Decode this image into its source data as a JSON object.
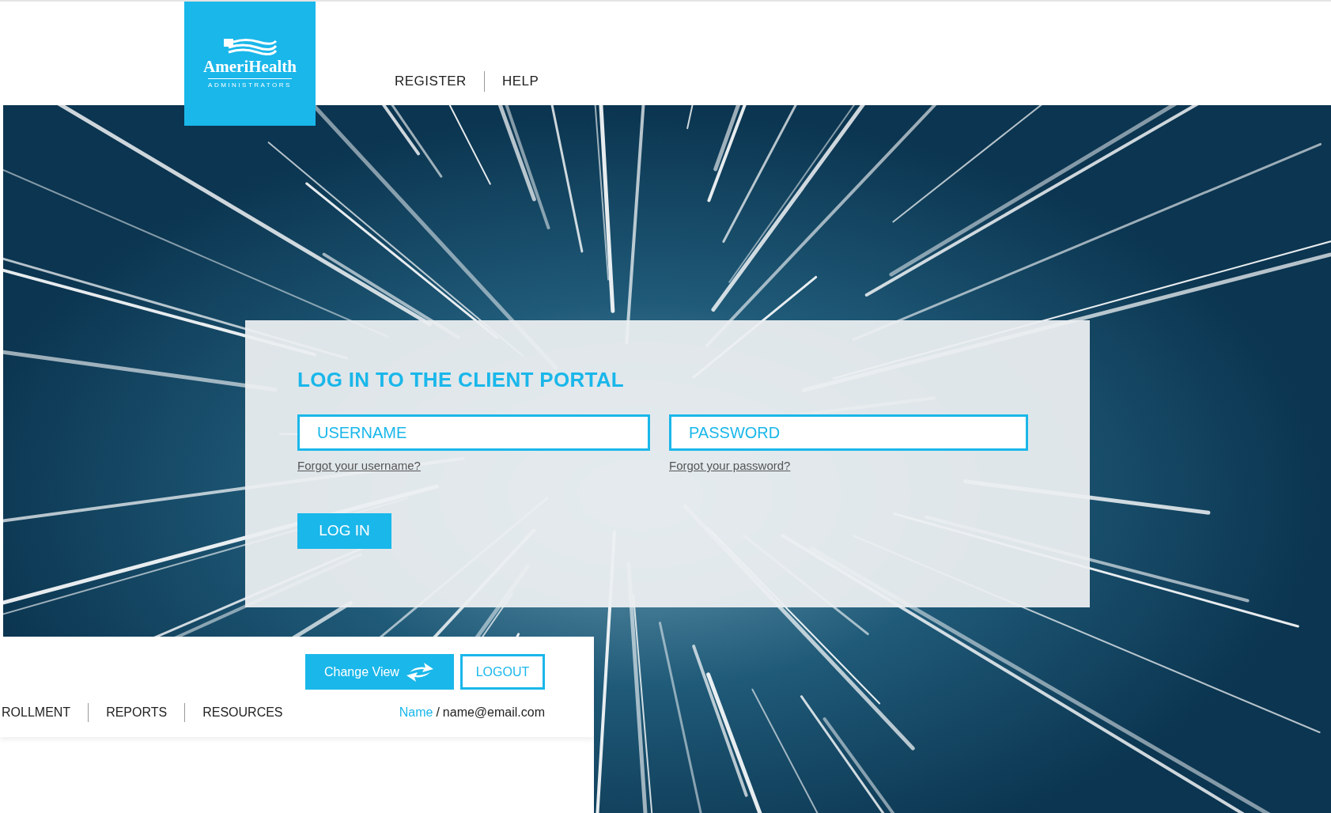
{
  "logo": {
    "name": "AmeriHealth",
    "tagline": "ADMINISTRATORS"
  },
  "top_nav": [
    {
      "label": "REGISTER"
    },
    {
      "label": "HELP"
    }
  ],
  "login": {
    "title": "LOG IN TO THE CLIENT PORTAL",
    "username": {
      "placeholder": "USERNAME"
    },
    "password": {
      "placeholder": "PASSWORD"
    },
    "forgot_username": "Forgot your username?",
    "forgot_password": "Forgot your password?",
    "submit": "LOG IN"
  },
  "overlay_panel": {
    "change_view": "Change View",
    "logout": "LOGOUT",
    "nav": [
      {
        "label": "ROLLMENT"
      },
      {
        "label": "REPORTS"
      },
      {
        "label": "RESOURCES"
      }
    ],
    "user": {
      "name": "Name",
      "separator": "/",
      "email": "name@email.com"
    }
  }
}
